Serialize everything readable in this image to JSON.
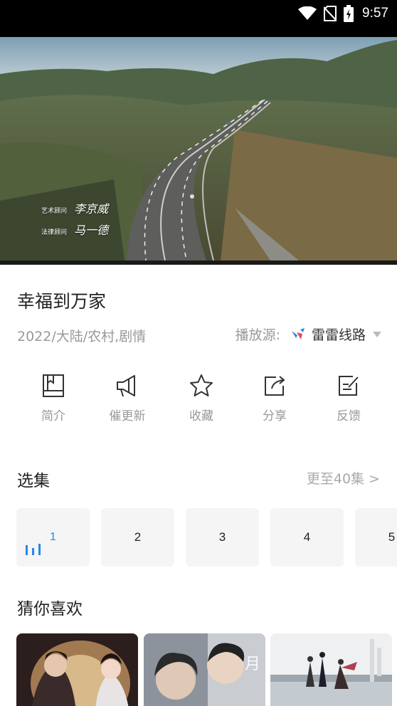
{
  "status_bar": {
    "time": "9:57",
    "icons": [
      "wifi-icon",
      "no-sim-icon",
      "battery-charging-icon"
    ]
  },
  "video": {
    "credits": [
      {
        "role": "艺术顾问",
        "name": "李京威"
      },
      {
        "role": "法律顾问",
        "name": "马一德"
      }
    ]
  },
  "show": {
    "title": "幸福到万家",
    "meta": "2022/大陆/农村,剧情",
    "source_label": "播放源:",
    "source_name": "雷雷线路"
  },
  "actions": [
    {
      "label": "简介",
      "icon": "book-icon"
    },
    {
      "label": "催更新",
      "icon": "megaphone-icon"
    },
    {
      "label": "收藏",
      "icon": "star-icon"
    },
    {
      "label": "分享",
      "icon": "share-icon"
    },
    {
      "label": "反馈",
      "icon": "feedback-icon"
    }
  ],
  "episodes_section": {
    "title": "选集",
    "more": "更至40集 >",
    "episodes": [
      "1",
      "2",
      "3",
      "4",
      "5"
    ],
    "active_episode": "1"
  },
  "recommend_section": {
    "title": "猜你喜欢"
  },
  "colors": {
    "accent": "#2a86e8",
    "muted": "#999999",
    "tile": "#f5f5f5"
  }
}
